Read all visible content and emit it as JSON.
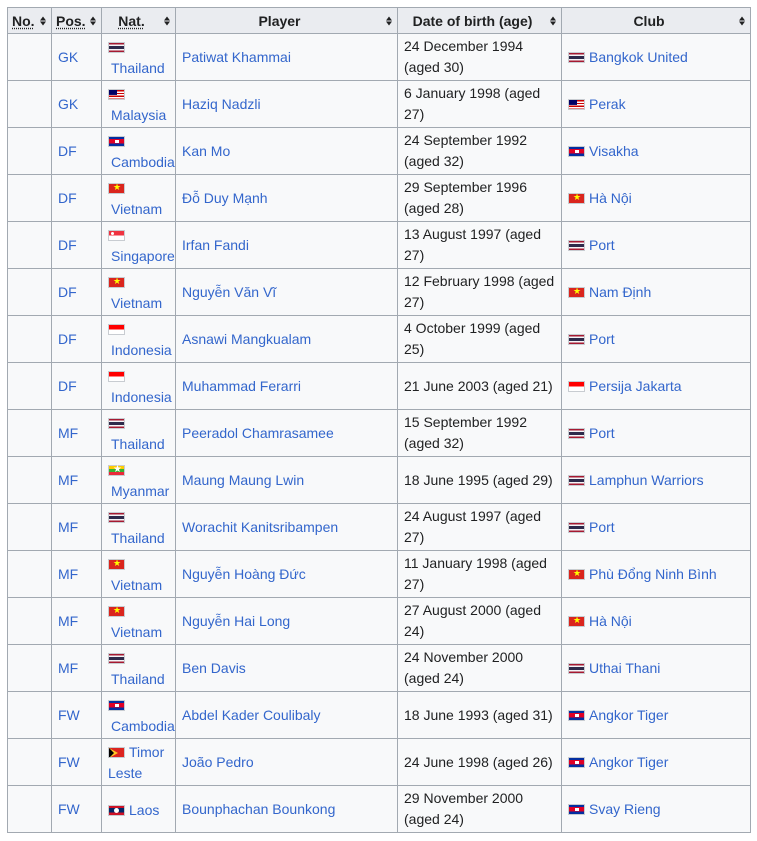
{
  "headers": {
    "no": "No.",
    "pos": "Pos.",
    "nat": "Nat.",
    "player": "Player",
    "dob": "Date of birth (age)",
    "club": "Club"
  },
  "rows": [
    {
      "pos": "GK",
      "nat": "Thailand",
      "nat_flag": "thailand",
      "player": "Patiwat Khammai",
      "dob": "24 December 1994 (aged 30)",
      "club": "Bangkok United",
      "club_flag": "thailand"
    },
    {
      "pos": "GK",
      "nat": "Malaysia",
      "nat_flag": "malaysia",
      "player": "Haziq Nadzli",
      "dob": "6 January 1998 (aged 27)",
      "club": "Perak",
      "club_flag": "malaysia"
    },
    {
      "pos": "DF",
      "nat": "Cambodia",
      "nat_flag": "cambodia",
      "player": "Kan Mo",
      "dob": "24 September 1992 (aged 32)",
      "club": "Visakha",
      "club_flag": "cambodia"
    },
    {
      "pos": "DF",
      "nat": "Vietnam",
      "nat_flag": "vietnam",
      "player": "Đỗ Duy Mạnh",
      "dob": "29 September 1996 (aged 28)",
      "club": "Hà Nội",
      "club_flag": "vietnam"
    },
    {
      "pos": "DF",
      "nat": "Singapore",
      "nat_flag": "singapore",
      "player": "Irfan Fandi",
      "dob": "13 August 1997 (aged 27)",
      "club": "Port",
      "club_flag": "thailand"
    },
    {
      "pos": "DF",
      "nat": "Vietnam",
      "nat_flag": "vietnam",
      "player": "Nguyễn Văn Vĩ",
      "dob": "12 February 1998 (aged 27)",
      "club": "Nam Định",
      "club_flag": "vietnam"
    },
    {
      "pos": "DF",
      "nat": "Indonesia",
      "nat_flag": "indonesia",
      "player": "Asnawi Mangkualam",
      "dob": "4 October 1999 (aged 25)",
      "club": "Port",
      "club_flag": "thailand"
    },
    {
      "pos": "DF",
      "nat": "Indonesia",
      "nat_flag": "indonesia",
      "player": "Muhammad Ferarri",
      "dob": "21 June 2003 (aged 21)",
      "club": "Persija Jakarta",
      "club_flag": "indonesia"
    },
    {
      "pos": "MF",
      "nat": "Thailand",
      "nat_flag": "thailand",
      "player": "Peeradol Chamrasamee",
      "dob": "15 September 1992 (aged 32)",
      "club": "Port",
      "club_flag": "thailand"
    },
    {
      "pos": "MF",
      "nat": "Myanmar",
      "nat_flag": "myanmar",
      "player": "Maung Maung Lwin",
      "dob": "18 June 1995 (aged 29)",
      "club": "Lamphun Warriors",
      "club_flag": "thailand"
    },
    {
      "pos": "MF",
      "nat": "Thailand",
      "nat_flag": "thailand",
      "player": "Worachit Kanitsribampen",
      "dob": "24 August 1997 (aged 27)",
      "club": "Port",
      "club_flag": "thailand"
    },
    {
      "pos": "MF",
      "nat": "Vietnam",
      "nat_flag": "vietnam",
      "player": "Nguyễn Hoàng Đức",
      "dob": "11 January 1998 (aged 27)",
      "club": "Phù Đổng Ninh Bình",
      "club_flag": "vietnam"
    },
    {
      "pos": "MF",
      "nat": "Vietnam",
      "nat_flag": "vietnam",
      "player": "Nguyễn Hai Long",
      "dob": "27 August 2000 (aged 24)",
      "club": "Hà Nội",
      "club_flag": "vietnam"
    },
    {
      "pos": "MF",
      "nat": "Thailand",
      "nat_flag": "thailand",
      "player": "Ben Davis",
      "dob": "24 November 2000 (aged 24)",
      "club": "Uthai Thani",
      "club_flag": "thailand"
    },
    {
      "pos": "FW",
      "nat": "Cambodia",
      "nat_flag": "cambodia",
      "player": "Abdel Kader Coulibaly",
      "dob": "18 June 1993 (aged 31)",
      "club": "Angkor Tiger",
      "club_flag": "cambodia"
    },
    {
      "pos": "FW",
      "nat": "Timor Leste",
      "nat_flag": "timor",
      "player": "João Pedro",
      "dob": "24 June 1998 (aged 26)",
      "club": "Angkor Tiger",
      "club_flag": "cambodia",
      "nat_inline": true
    },
    {
      "pos": "FW",
      "nat": "Laos",
      "nat_flag": "laos",
      "player": "Bounphachan Bounkong",
      "dob": "29 November 2000 (aged 24)",
      "club": "Svay Rieng",
      "club_flag": "cambodia",
      "nat_inline": true
    }
  ]
}
